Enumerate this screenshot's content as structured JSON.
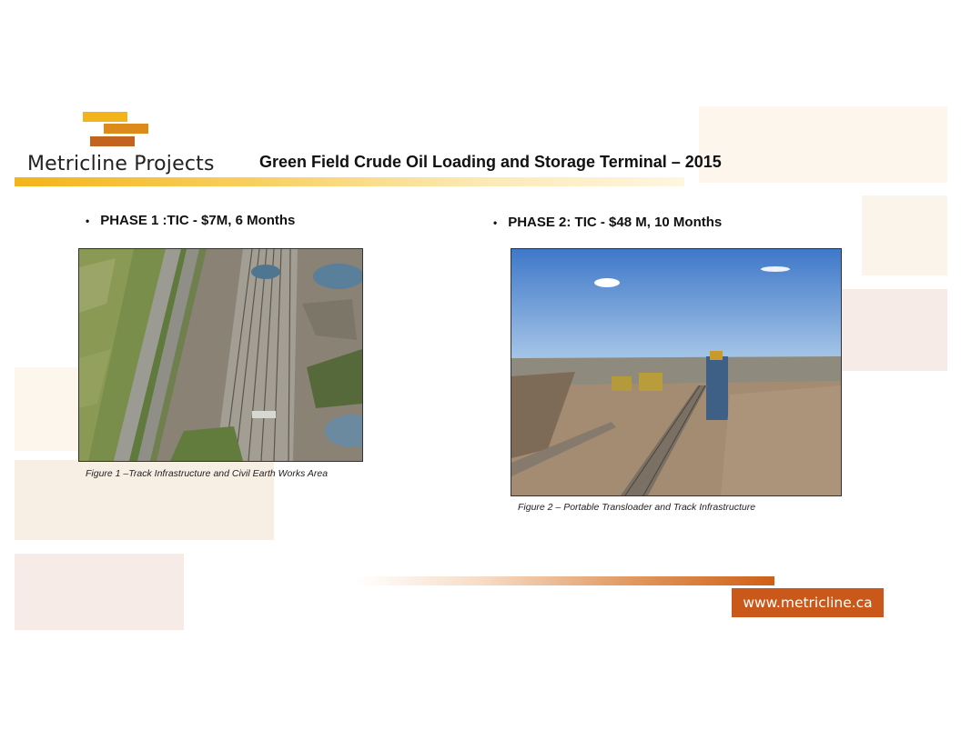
{
  "brand": {
    "name": "Metricline Projects"
  },
  "title": "Green Field Crude Oil Loading and Storage Terminal – 2015",
  "phases": [
    {
      "bullet": "•",
      "label": "PHASE 1 :TIC - $7M, 6 Months"
    },
    {
      "bullet": "•",
      "label": "PHASE 2: TIC - $48 M, 10 Months"
    }
  ],
  "figures": [
    {
      "caption": "Figure 1 –Track Infrastructure and Civil Earth Works Area"
    },
    {
      "caption": "Figure 2 – Portable Transloader and Track Infrastructure"
    }
  ],
  "footer": {
    "url": "www.metricline.ca"
  },
  "colors": {
    "gold": "#f3b41b",
    "orange": "#dc8a1a",
    "rust": "#c9581a"
  }
}
